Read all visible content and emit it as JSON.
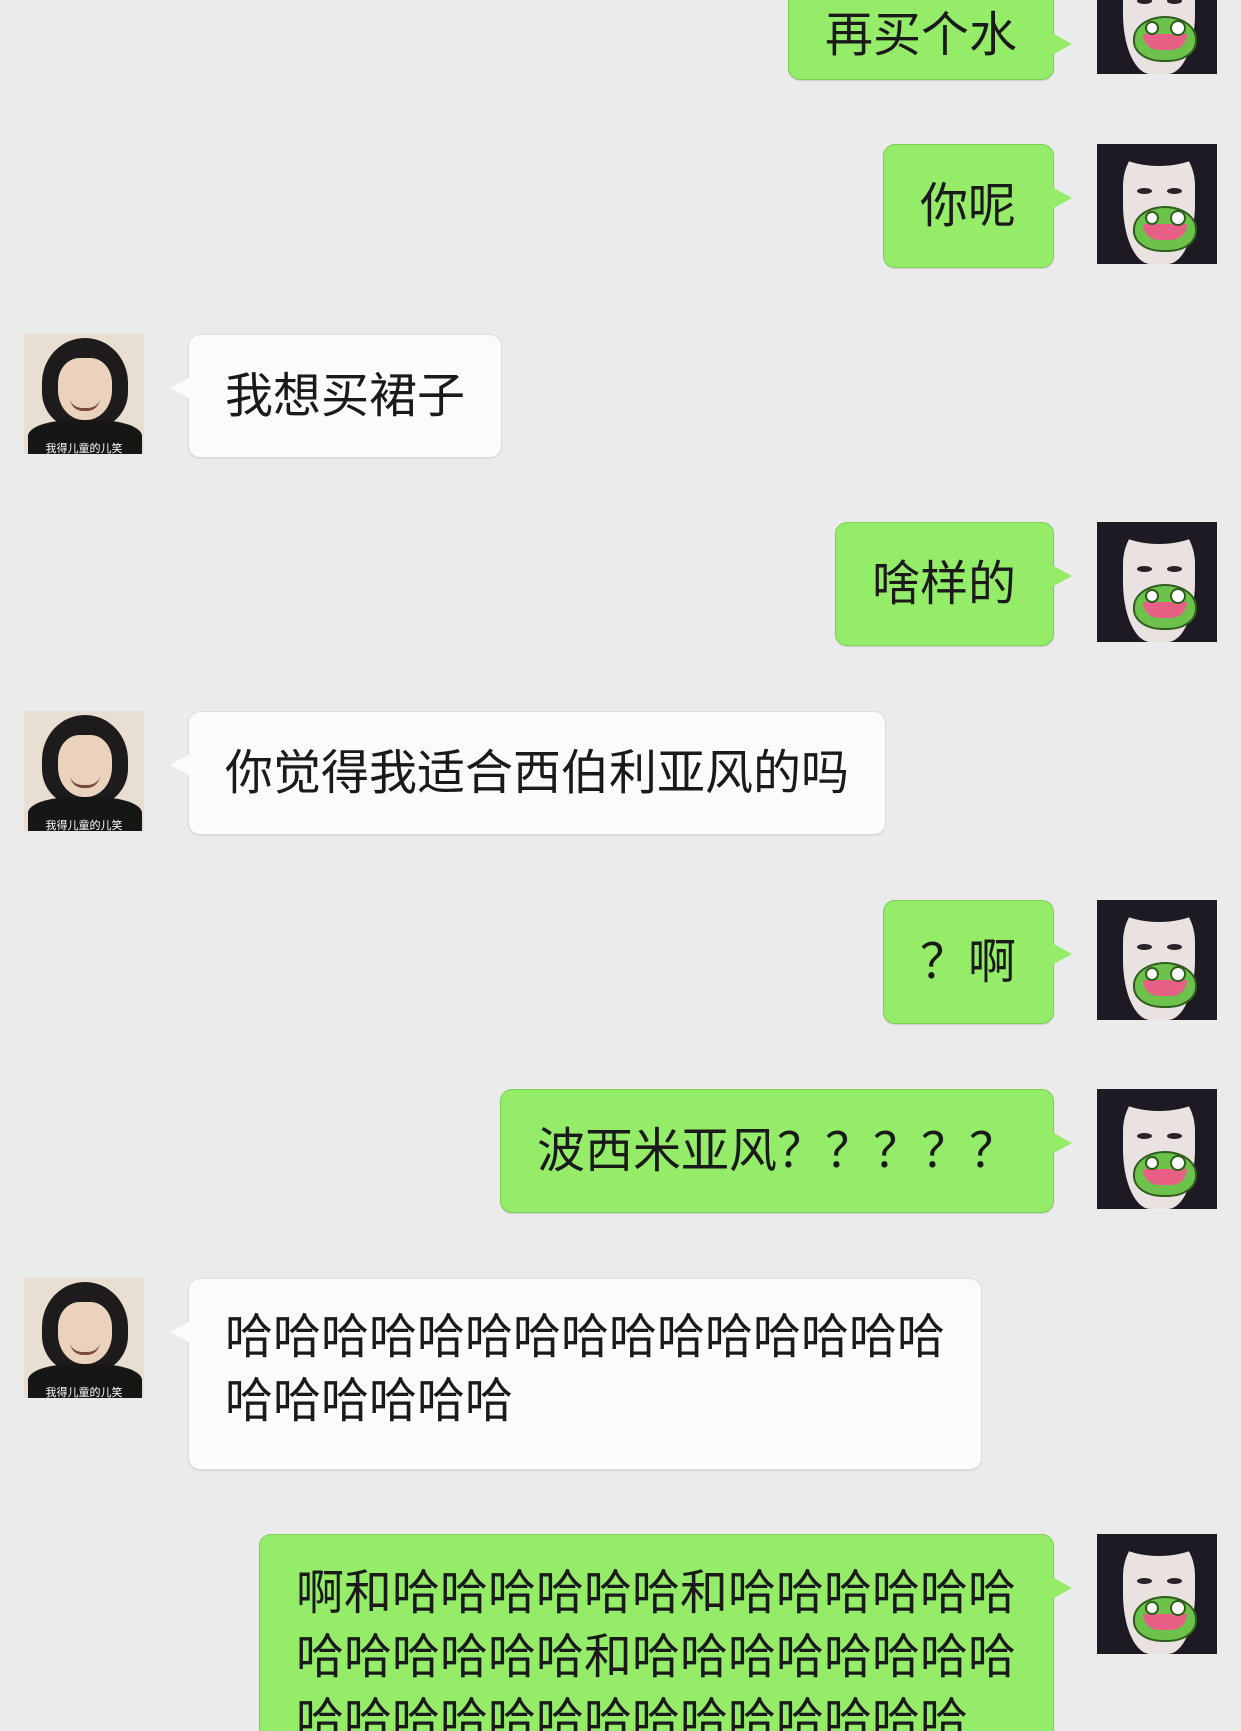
{
  "chat": {
    "messages": [
      {
        "side": "right",
        "text": "再买个水"
      },
      {
        "side": "right",
        "text": "你呢"
      },
      {
        "side": "left",
        "text": "我想买裙子",
        "avatar_caption": "我得儿童的儿笑"
      },
      {
        "side": "right",
        "text": "啥样的"
      },
      {
        "side": "left",
        "text": "你觉得我适合西伯利亚风的吗",
        "avatar_caption": "我得儿童的儿笑"
      },
      {
        "side": "right",
        "text": "？啊"
      },
      {
        "side": "right",
        "text": "波西米亚风？？？？？"
      },
      {
        "side": "left",
        "text": "哈哈哈哈哈哈哈哈哈哈哈哈哈哈哈哈哈哈哈哈哈",
        "avatar_caption": "我得儿童的儿笑"
      },
      {
        "side": "right",
        "text": "啊和哈哈哈哈哈哈和哈哈哈哈哈哈哈哈哈哈哈哈和哈哈哈哈哈哈哈哈哈哈哈哈哈哈哈哈哈哈哈哈哈哈"
      }
    ]
  },
  "colors": {
    "background": "#ebebeb",
    "bubble_self": "#95ec69",
    "bubble_other": "#fbfbfb"
  }
}
